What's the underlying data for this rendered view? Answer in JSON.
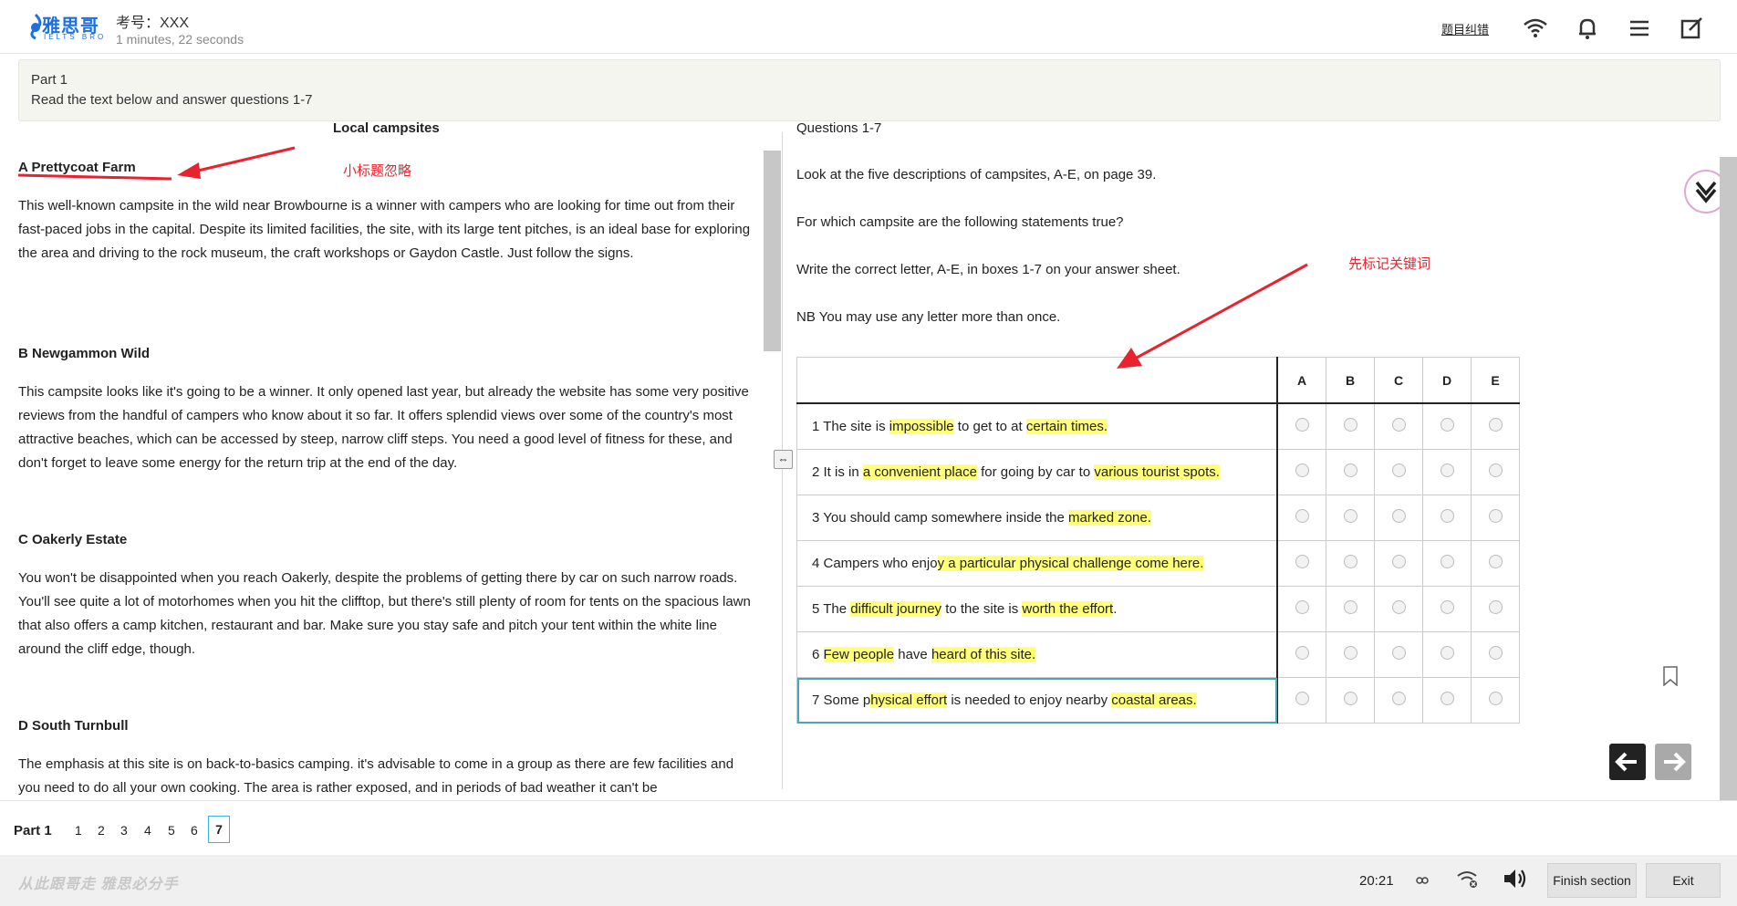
{
  "header": {
    "logo_text": "雅思哥",
    "logo_sub": "IELTS BRO",
    "exam_no": "考号：XXX",
    "timer": "1 minutes, 22 seconds",
    "report_link": "题目纠错",
    "icons": [
      "wifi-icon",
      "bell-icon",
      "menu-icon",
      "edit-icon"
    ]
  },
  "banner": {
    "title": "Part 1",
    "instruction": "Read the text below and answer questions 1-7"
  },
  "passage": {
    "title": "Local campsites",
    "sections": [
      {
        "heading": "A  Prettycoat Farm",
        "body": "This well-known campsite in the wild near Browbourne is a winner with campers who are looking for time out from their fast-paced jobs in the capital. Despite its limited facilities, the site, with its large tent pitches, is an ideal base for exploring the area and driving to the rock museum, the craft workshops or Gaydon Castle. Just follow the signs."
      },
      {
        "heading": "B  Newgammon Wild",
        "body": "This campsite looks like it's going to be a winner. It only opened last year, but already the website has some very positive reviews from the handful of campers who know about it so far. It offers splendid views over some of the country's most attractive beaches, which can be accessed by steep, narrow cliff steps. You need a good level of fitness for these, and don't forget to leave some energy for the return trip at the end of the day."
      },
      {
        "heading": "C  Oakerly Estate",
        "body": "You won't be disappointed when you reach Oakerly, despite the problems of getting there by car on such narrow roads. You'll see quite a lot of motorhomes when you hit the clifftop, but there's still plenty of room for tents on the spacious lawn that also offers a camp kitchen, restaurant and bar. Make sure you stay safe and pitch your tent within the white line around the cliff edge, though."
      },
      {
        "heading": "D  South Turnbull",
        "body": "The emphasis at this site is on back-to-basics camping. it's advisable to come in a group as there are few facilities and you need to do all your own cooking. The area is rather exposed, and in periods of bad weather it can't be"
      }
    ]
  },
  "annotations": {
    "left_note": "小标题忽略",
    "right_note": "先标记关键词"
  },
  "questions": {
    "heading": "Questions 1-7",
    "instr1": "Look at the five descriptions of campsites, A-E, on page 39.",
    "instr2": "For which campsite are the following statements true?",
    "instr3": "Write the correct letter, A-E, in boxes 1-7 on your answer sheet.",
    "instr4": "NB You may use any letter more than once.",
    "options": [
      "A",
      "B",
      "C",
      "D",
      "E"
    ],
    "rows": [
      {
        "parts": [
          [
            "1 The site is ",
            false
          ],
          [
            "impossible",
            true
          ],
          [
            " to get to at ",
            false
          ],
          [
            "certain times.",
            true
          ]
        ]
      },
      {
        "parts": [
          [
            "2 It is in ",
            false
          ],
          [
            "a convenient place",
            true
          ],
          [
            " for going by car to ",
            false
          ],
          [
            "various tourist spots.",
            true
          ]
        ]
      },
      {
        "parts": [
          [
            "3 You should camp somewhere inside the ",
            false
          ],
          [
            "marked zone.",
            true
          ]
        ]
      },
      {
        "parts": [
          [
            "4 Campers who enjo",
            false
          ],
          [
            "y a particular physical challenge come here.",
            true
          ]
        ]
      },
      {
        "parts": [
          [
            "5 The ",
            false
          ],
          [
            "difficult journey",
            true
          ],
          [
            " to the site is ",
            false
          ],
          [
            "worth the effort",
            true
          ],
          [
            ".",
            false
          ]
        ]
      },
      {
        "parts": [
          [
            "6 ",
            false
          ],
          [
            "Few people",
            true
          ],
          [
            " have ",
            false
          ],
          [
            "heard of this site.",
            true
          ]
        ]
      },
      {
        "parts": [
          [
            "7 Some p",
            false
          ],
          [
            "hysical effort",
            true
          ],
          [
            " is needed to enjoy nearby ",
            false
          ],
          [
            "coastal areas.",
            true
          ]
        ]
      }
    ]
  },
  "partnav": {
    "label": "Part 1",
    "numbers": [
      "1",
      "2",
      "3",
      "4",
      "5",
      "6",
      "7"
    ],
    "current": "7"
  },
  "footer": {
    "slogan": "从此跟哥走  雅思必分手",
    "clock": "20:21",
    "finish": "Finish section",
    "exit": "Exit"
  },
  "colors": {
    "brand": "#1e6fd9",
    "highlight": "#ffff7a",
    "annotation": "#e8232f",
    "active_border": "#3bb6d4"
  }
}
